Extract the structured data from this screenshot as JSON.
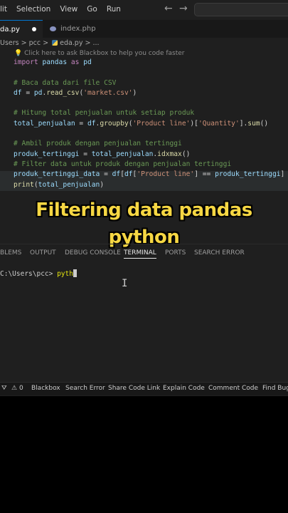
{
  "menu": {
    "items": [
      "lit",
      "Selection",
      "View",
      "Go",
      "Run"
    ]
  },
  "nav": {
    "back": "←",
    "forward": "→"
  },
  "tabs": [
    {
      "label": "da.py",
      "active": true,
      "modified": true
    },
    {
      "label": "index.php",
      "active": false
    }
  ],
  "breadcrumb": "Users > pcc > ",
  "breadcrumb_file": "eda.py > ...",
  "hint": "Click here to ask Blackbox to help you code faster",
  "code": [
    "import pandas as pd",
    "",
    "# Baca data dari file CSV",
    "df = pd.read_csv('market.csv')",
    "",
    "# Hitung total penjualan untuk setiap produk",
    "total_penjualan = df.groupby('Product line')['Quantity'].sum()",
    "",
    "# Ambil produk dengan penjualan tertinggi",
    "produk_tertinggi = total_penjualan.idxmax()",
    "# Filter data untuk produk dengan penjualan tertinggi",
    "produk_tertinggi_data = df[df['Product line'] == produk_tertinggi]",
    "print(total_penjualan)"
  ],
  "overlay": {
    "line1": "Filtering data pandas",
    "line2": "python"
  },
  "panel": {
    "tabs": [
      "BLEMS",
      "OUTPUT",
      "DEBUG CONSOLE",
      "TERMINAL",
      "PORTS",
      "SEARCH ERROR"
    ],
    "active": "TERMINAL"
  },
  "terminal": {
    "prompt": "C:\\Users\\pcc> ",
    "command": "pyth"
  },
  "status": {
    "problems": "0",
    "items": [
      "Blackbox",
      "Search Error",
      "Share Code Link",
      "Explain Code",
      "Comment Code",
      "Find Bugs"
    ]
  },
  "colors": {
    "overlay_text": "#f6d743",
    "accent": "#0078d4"
  }
}
